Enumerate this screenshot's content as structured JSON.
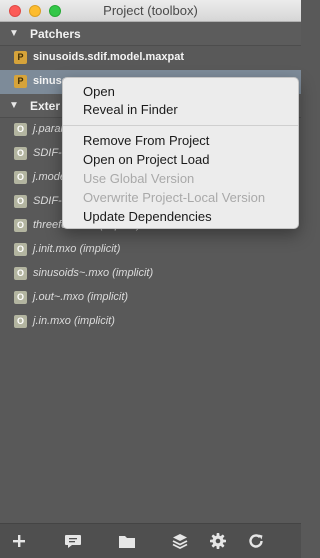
{
  "window": {
    "title": "Project (toolbox)"
  },
  "sections": [
    {
      "label": "Patchers"
    },
    {
      "label": "Exter"
    }
  ],
  "patchers": [
    {
      "badge": "P",
      "name": "sinusoids.sdif.model.maxpat",
      "selected": false
    },
    {
      "badge": "P",
      "name": "sinuso",
      "selected": true
    }
  ],
  "externals": [
    {
      "badge": "O",
      "name": "j.paran"
    },
    {
      "badge": "O",
      "name": "SDIF-b"
    },
    {
      "badge": "O",
      "name": "j.mode"
    },
    {
      "badge": "O",
      "name": "SDIF-t"
    },
    {
      "badge": "O",
      "name": "threefoldmxo (implicit)"
    },
    {
      "badge": "O",
      "name": "j.init.mxo (implicit)"
    },
    {
      "badge": "O",
      "name": "sinusoids~.mxo (implicit)"
    },
    {
      "badge": "O",
      "name": "j.out~.mxo (implicit)"
    },
    {
      "badge": "O",
      "name": "j.in.mxo (implicit)"
    }
  ],
  "context_menu": {
    "items": [
      {
        "label": "Open",
        "enabled": true
      },
      {
        "label": "Reveal in Finder",
        "enabled": true
      },
      {
        "label": "Remove From Project",
        "enabled": true
      },
      {
        "label": "Open on Project Load",
        "enabled": true
      },
      {
        "label": "Use Global Version",
        "enabled": false
      },
      {
        "label": "Overwrite Project-Local Version",
        "enabled": false
      },
      {
        "label": "Update Dependencies",
        "enabled": true
      }
    ]
  },
  "toolbar": {
    "icons": [
      "add-icon",
      "comment-icon",
      "folder-icon",
      "layers-icon",
      "gear-icon",
      "refresh-icon"
    ]
  },
  "colors": {
    "panel_bg": "#595959",
    "selected_row": "#7d8b99",
    "patcher_badge": "#d6a33a",
    "external_badge": "#b3b5a0",
    "menu_bg": "#ececec",
    "disabled_text": "#a9a9a9"
  }
}
